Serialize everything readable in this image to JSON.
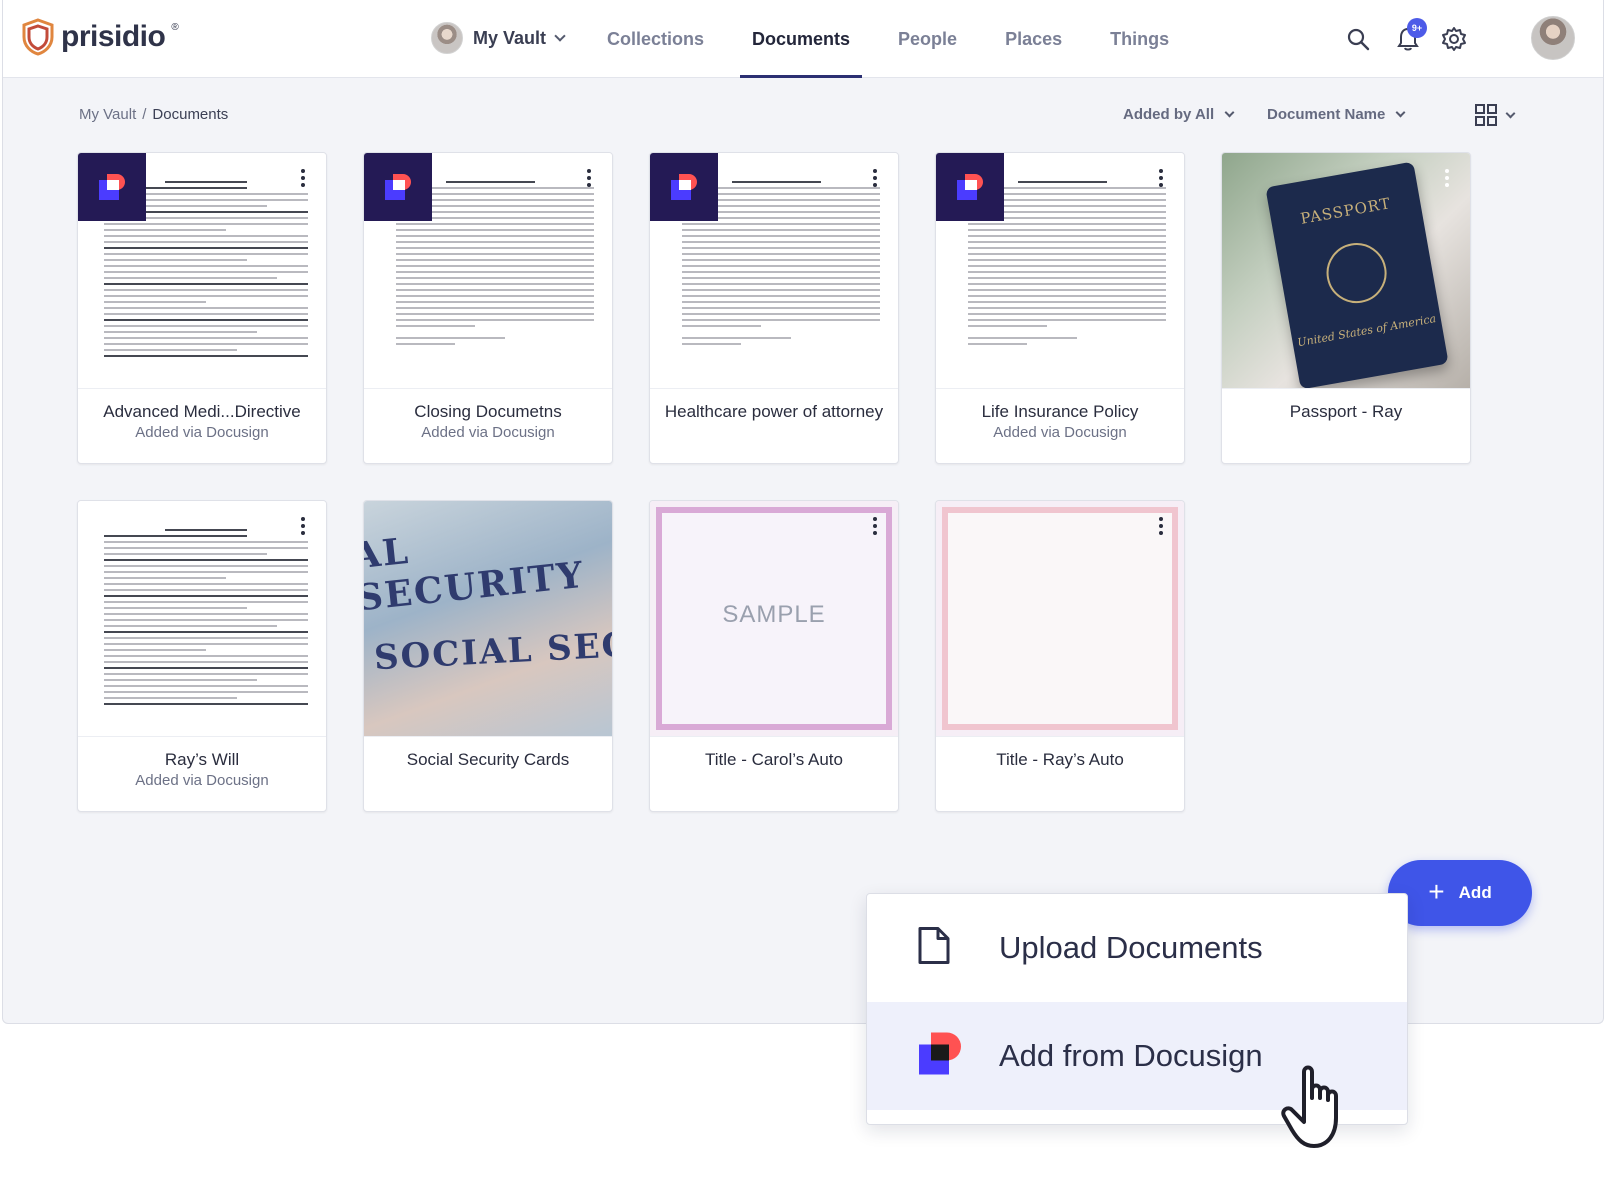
{
  "brand": {
    "name": "prisidio",
    "reg": "®"
  },
  "header": {
    "vault_label": "My Vault",
    "tabs": [
      {
        "label": "Collections",
        "active": false
      },
      {
        "label": "Documents",
        "active": true
      },
      {
        "label": "People",
        "active": false
      },
      {
        "label": "Places",
        "active": false
      },
      {
        "label": "Things",
        "active": false
      }
    ],
    "notification_badge": "9+",
    "accent": "#3f55e8"
  },
  "breadcrumb": {
    "root": "My Vault",
    "separator": "/",
    "current": "Documents"
  },
  "filters": {
    "added_by": "Added by All",
    "sort": "Document Name"
  },
  "documents": [
    {
      "title": "Advanced Medi...Directive",
      "subtitle": "Added via Docusign"
    },
    {
      "title": "Closing Documetns",
      "subtitle": "Added via Docusign"
    },
    {
      "title": "Healthcare power of attorney",
      "subtitle": ""
    },
    {
      "title": "Life Insurance Policy",
      "subtitle": "Added via Docusign"
    },
    {
      "title": "Passport - Ray",
      "subtitle": ""
    },
    {
      "title": "Ray’s Will",
      "subtitle": "Added via Docusign"
    },
    {
      "title": "Social Security Cards",
      "subtitle": ""
    },
    {
      "title": "Title - Carol’s Auto",
      "subtitle": ""
    },
    {
      "title": "Title - Ray’s Auto",
      "subtitle": ""
    }
  ],
  "thumb_text": {
    "passport_title": "PASSPORT",
    "passport_country": "United States of America",
    "ssc_top": "AL SECURITY",
    "ssc_bottom": "SOCIAL SEC",
    "sample": "SAMPLE"
  },
  "add_button": {
    "label": "Add"
  },
  "add_menu": {
    "items": [
      {
        "label": "Upload Documents",
        "icon": "file-icon"
      },
      {
        "label": "Add from Docusign",
        "icon": "docusign-icon"
      }
    ]
  }
}
